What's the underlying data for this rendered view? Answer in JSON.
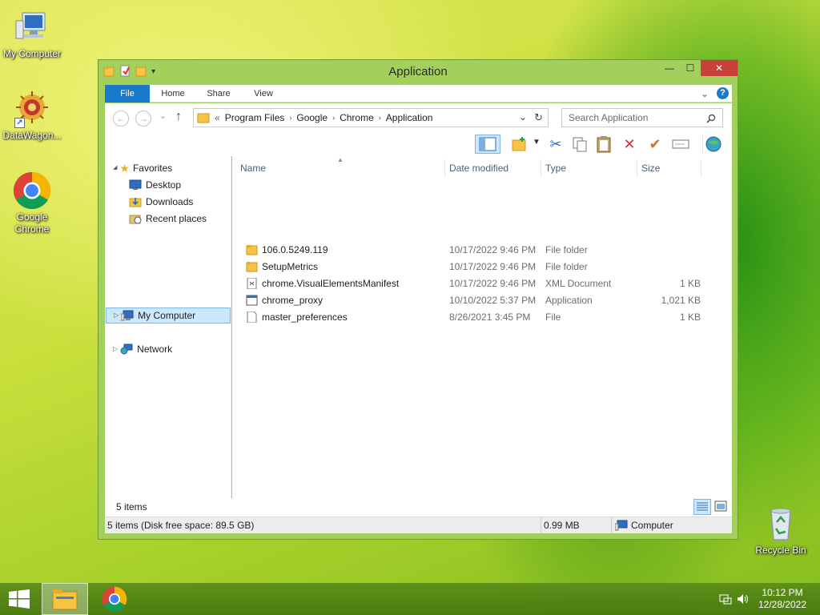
{
  "desktop": {
    "icons": [
      {
        "label": "My Computer"
      },
      {
        "label": "DataWagon..."
      },
      {
        "label": "Google Chrome"
      },
      {
        "label": "Recycle Bin"
      }
    ]
  },
  "window": {
    "title": "Application",
    "controls": {
      "minimize": "—",
      "maximize": "☐",
      "close": "✕"
    },
    "ribbon_tabs": [
      "File",
      "Home",
      "Share",
      "View"
    ],
    "ribbon_collapse": "⌄",
    "help": "?",
    "address": {
      "prefix": "«",
      "crumbs": [
        "Program Files",
        "Google",
        "Chrome",
        "Application"
      ],
      "separator": "›",
      "dropdown": "⌄",
      "refresh": "↻"
    },
    "search": {
      "placeholder": "Search Application"
    },
    "nav_buttons": {
      "back": "←",
      "forward": "→",
      "recent": "⌄",
      "up": "↑"
    }
  },
  "nav_pane": {
    "favorites_label": "Favorites",
    "favorites": [
      "Desktop",
      "Downloads",
      "Recent places"
    ],
    "computer_label": "My Computer",
    "network_label": "Network",
    "expand_glyph": "▷",
    "collapse_glyph": "◢"
  },
  "file_list": {
    "columns": [
      "Name",
      "Date modified",
      "Type",
      "Size"
    ],
    "rows": [
      {
        "name": "106.0.5249.119",
        "date": "10/17/2022 9:46 PM",
        "type": "File folder",
        "size": "",
        "icon": "folder-icon"
      },
      {
        "name": "SetupMetrics",
        "date": "10/17/2022 9:46 PM",
        "type": "File folder",
        "size": "",
        "icon": "folder-icon"
      },
      {
        "name": "chrome.VisualElementsManifest",
        "date": "10/17/2022 9:46 PM",
        "type": "XML Document",
        "size": "1 KB",
        "icon": "xml-file-icon"
      },
      {
        "name": "chrome_proxy",
        "date": "10/10/2022 5:37 PM",
        "type": "Application",
        "size": "1,021 KB",
        "icon": "application-icon"
      },
      {
        "name": "master_preferences",
        "date": "8/26/2021 3:45 PM",
        "type": "File",
        "size": "1 KB",
        "icon": "file-icon"
      }
    ]
  },
  "status": {
    "item_count": "5 items",
    "details": "5 items (Disk free space: 89.5 GB)",
    "size": "0.99 MB",
    "location": "Computer"
  },
  "taskbar": {
    "clock_time": "10:12 PM",
    "clock_date": "12/28/2022"
  },
  "colors": {
    "accent": "#1979ca",
    "window_frame": "#a3d05c",
    "close_button": "#c7413a",
    "selection": "#cce8ff"
  }
}
